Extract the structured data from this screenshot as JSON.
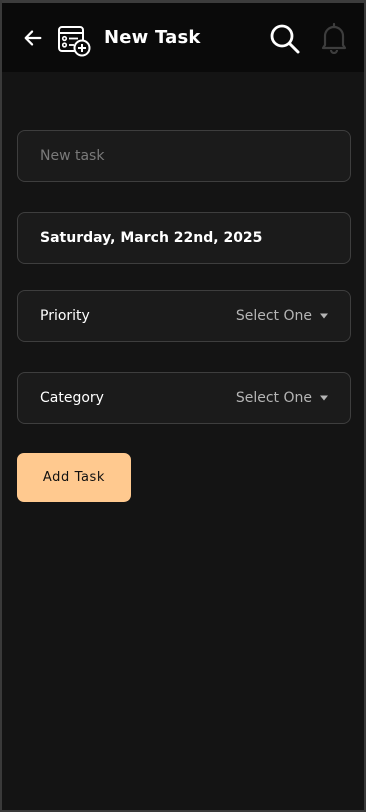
{
  "header": {
    "title": "New Task",
    "icons": {
      "back": "arrow-left-icon",
      "task": "task-list-add-icon",
      "search": "search-icon",
      "notifications": "bell-icon"
    }
  },
  "form": {
    "task_input": {
      "value": "",
      "placeholder": "New task"
    },
    "date": {
      "value": "Saturday, March 22nd, 2025"
    },
    "priority": {
      "label": "Priority",
      "selected": "Select One"
    },
    "category": {
      "label": "Category",
      "selected": "Select One"
    },
    "submit_label": "Add Task"
  },
  "colors": {
    "background": "#141414",
    "header_background": "#0a0a0a",
    "field_background": "#1b1b1b",
    "field_border": "#3e3e3e",
    "accent": "#ffc98f",
    "text_primary": "#ffffff",
    "text_muted": "#b5b5b5"
  }
}
